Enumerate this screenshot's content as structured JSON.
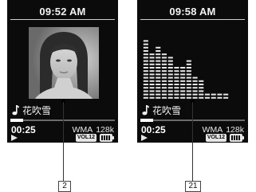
{
  "screens": [
    {
      "view": "album-art",
      "clock": "09:52 AM",
      "track_title": "花吹雪",
      "elapsed": "00:25",
      "format": "WMA",
      "bitrate": "128k",
      "volume_badge": "VOL12",
      "progress": 0.12,
      "callout": "2"
    },
    {
      "view": "spectrum",
      "clock": "09:58 AM",
      "track_title": "花吹雪",
      "elapsed": "00:25",
      "format": "WMA",
      "bitrate": "128k",
      "volume_badge": "VOL12",
      "progress": 0.12,
      "callout": "21",
      "spectrum_levels": [
        0.9,
        0.72,
        0.82,
        0.68,
        0.64,
        0.52,
        0.5,
        0.58,
        0.35,
        0.28,
        0.08,
        0.08,
        0.08,
        0.08
      ]
    }
  ],
  "icons": {
    "track": "music-note-icon",
    "play": "play-icon",
    "battery": "battery-icon"
  },
  "colors": {
    "screen_bg": "#0b0b0b",
    "screen_text": "#f3f3f3",
    "page_bg": "#ffffff"
  }
}
